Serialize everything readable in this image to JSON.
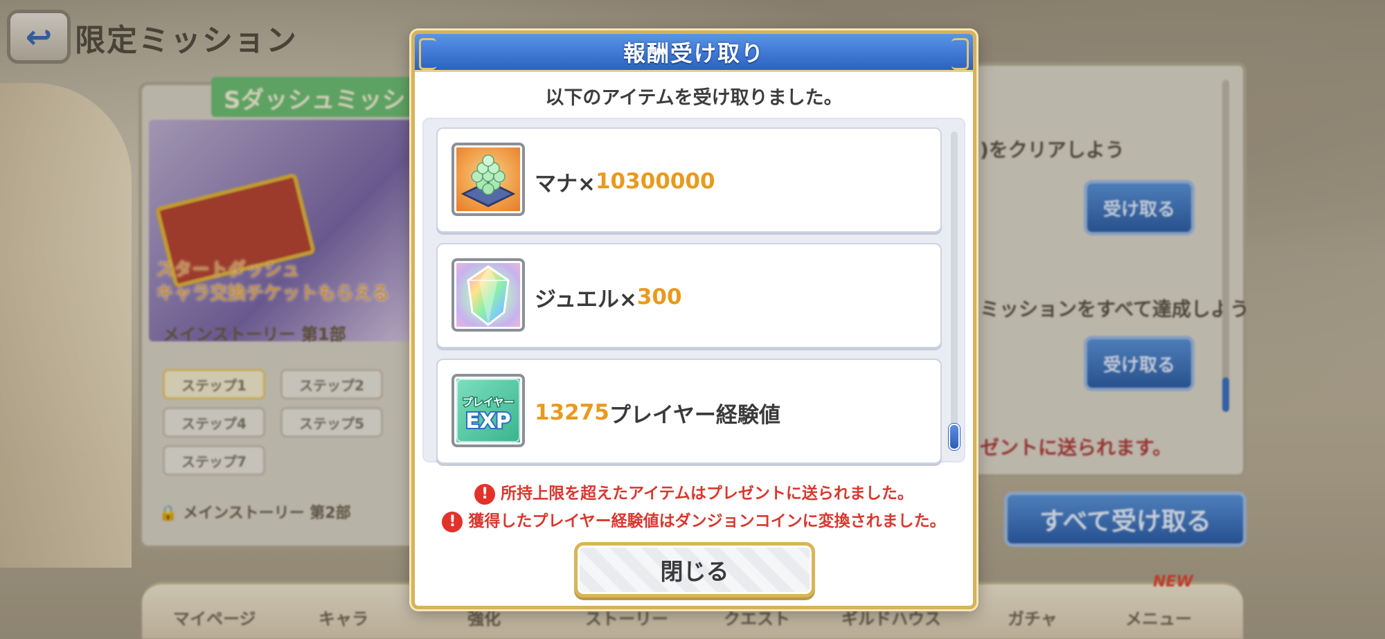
{
  "background": {
    "page_title": "限定ミッション",
    "back_icon": "back-arrow-icon",
    "left_panel": {
      "banner_title": "Sダッシュミッシ",
      "art_text_line1": "スタートダッシュ",
      "art_text_line2": "キャラ交換チケットもらえる",
      "subtitle": "メインストーリー 第1部",
      "steps": [
        "ステップ1",
        "ステップ2",
        "ステップ4",
        "ステップ5",
        "ステップ7"
      ],
      "locked_label": "メインストーリー 第2部"
    },
    "right_panel": {
      "mission1_text": ")をクリアしよう",
      "mission1_button": "受け取る",
      "mission2_text": "ミッションをすべて達成しよう",
      "mission2_button": "受け取る",
      "red_notice": "ゼントに送られます。"
    },
    "receive_all_button": "すべて受け取る",
    "nav": [
      "マイページ",
      "キャラ",
      "強化",
      "ストーリー",
      "クエスト",
      "ギルドハウス",
      "ガチャ",
      "メニュー"
    ],
    "nav_new_badge": "NEW"
  },
  "modal": {
    "title": "報酬受け取り",
    "subtitle": "以下のアイテムを受け取りました。",
    "items": [
      {
        "icon": "mana-icon",
        "prefix": "マナ×",
        "amount": "10300000",
        "suffix": ""
      },
      {
        "icon": "jewel-icon",
        "prefix": "ジュエル×",
        "amount": "300",
        "suffix": ""
      },
      {
        "icon": "player-exp-icon",
        "prefix": "",
        "amount": "13275",
        "suffix": "プレイヤー経験値",
        "icon_text_top": "プレイヤー",
        "icon_text_bottom": "EXP"
      }
    ],
    "notices": [
      "所持上限を超えたアイテムはプレゼントに送られました。",
      "獲得したプレイヤー経験値はダンジョンコインに変換されました。"
    ],
    "warning_glyph": "!",
    "close_button": "閉じる"
  },
  "colors": {
    "header_blue": "#3f78d4",
    "frame_gold": "#d6b25a",
    "amount_orange": "#e89a1f",
    "notice_red": "#d9372e"
  }
}
